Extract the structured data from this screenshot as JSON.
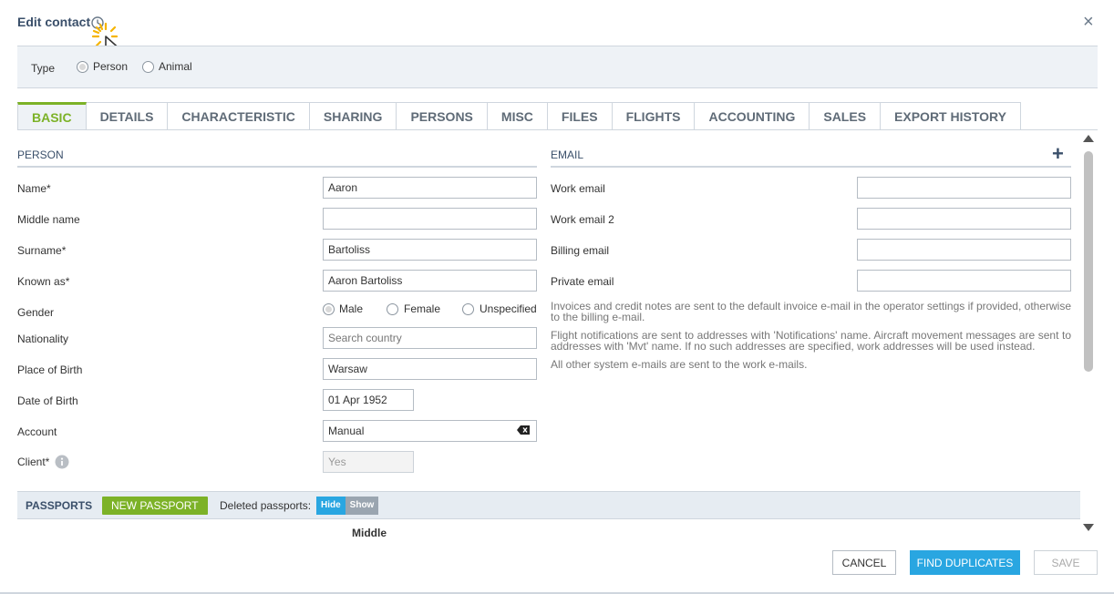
{
  "dialog": {
    "title": "Edit contact",
    "close_glyph": "×"
  },
  "type_selector": {
    "label": "Type",
    "options": [
      {
        "label": "Person",
        "selected": true
      },
      {
        "label": "Animal",
        "selected": false
      }
    ]
  },
  "tabs": [
    {
      "label": "BASIC",
      "active": true
    },
    {
      "label": "DETAILS",
      "active": false
    },
    {
      "label": "CHARACTERISTIC",
      "active": false
    },
    {
      "label": "SHARING",
      "active": false
    },
    {
      "label": "PERSONS",
      "active": false
    },
    {
      "label": "MISC",
      "active": false
    },
    {
      "label": "FILES",
      "active": false
    },
    {
      "label": "FLIGHTS",
      "active": false
    },
    {
      "label": "ACCOUNTING",
      "active": false
    },
    {
      "label": "SALES",
      "active": false
    },
    {
      "label": "EXPORT HISTORY",
      "active": false
    }
  ],
  "person": {
    "heading": "PERSON",
    "name": {
      "label": "Name*",
      "value": "Aaron"
    },
    "middle_name": {
      "label": "Middle name",
      "value": ""
    },
    "surname": {
      "label": "Surname*",
      "value": "Bartoliss"
    },
    "known_as": {
      "label": "Known as*",
      "value": "Aaron Bartoliss"
    },
    "gender": {
      "label": "Gender",
      "options": [
        {
          "label": "Male",
          "selected": true
        },
        {
          "label": "Female",
          "selected": false
        },
        {
          "label": "Unspecified",
          "selected": false
        }
      ]
    },
    "nationality": {
      "label": "Nationality",
      "placeholder": "Search country"
    },
    "place_of_birth": {
      "label": "Place of Birth",
      "value": "Warsaw"
    },
    "date_of_birth": {
      "label": "Date of Birth",
      "value": "01 Apr 1952"
    },
    "account": {
      "label": "Account",
      "value": "Manual"
    },
    "client": {
      "label": "Client*",
      "value": "Yes"
    }
  },
  "email": {
    "heading": "EMAIL",
    "add_glyph": "+",
    "fields": [
      {
        "label": "Work email",
        "value": ""
      },
      {
        "label": "Work email 2",
        "value": ""
      },
      {
        "label": "Billing email",
        "value": ""
      },
      {
        "label": "Private email",
        "value": ""
      }
    ],
    "notes": [
      "Invoices and credit notes are sent to the default invoice e-mail in the operator settings if provided, otherwise to the billing e-mail.",
      "Flight notifications are sent to addresses with 'Notifications' name. Aircraft movement messages are sent to addresses with 'Mvt' name. If no such addresses are specified, work addresses will be used instead.",
      "All other system e-mails are sent to the work e-mails."
    ]
  },
  "passports": {
    "heading": "PASSPORTS",
    "new_button": "NEW PASSPORT",
    "deleted_label": "Deleted passports:",
    "hide_label": "Hide",
    "show_label": "Show",
    "partial_column_header": "Middle"
  },
  "footer": {
    "cancel": "CANCEL",
    "find_duplicates": "FIND DUPLICATES",
    "save": "SAVE"
  },
  "icons": {
    "history": "history-icon",
    "close": "close-icon",
    "add": "plus-icon",
    "info": "info-icon",
    "clear": "backspace-icon",
    "cursor": "mouse-cursor-icon"
  },
  "colors": {
    "accent_green": "#7cb227",
    "primary_blue": "#29a6e1",
    "title_navy": "#3a4f6a",
    "panel_bg": "#eef2f6"
  }
}
